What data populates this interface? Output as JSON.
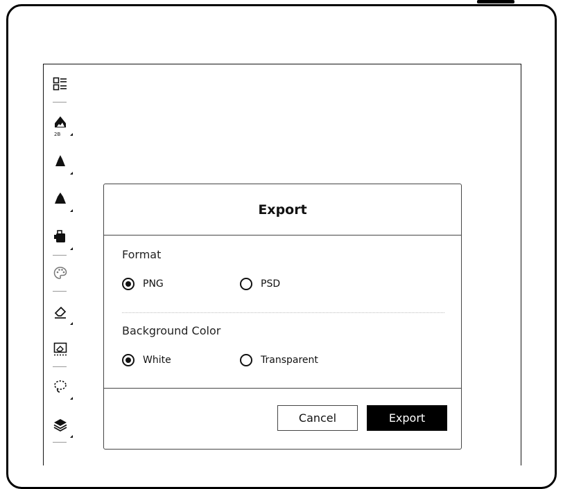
{
  "toolbar": {
    "items": [
      {
        "icon": "outline-list-icon"
      },
      {
        "icon": "pencil-icon",
        "label": "2B"
      },
      {
        "icon": "brush-icon"
      },
      {
        "icon": "marker-icon"
      },
      {
        "icon": "fill-bucket-icon"
      },
      {
        "icon": "palette-icon"
      },
      {
        "icon": "eraser-icon"
      },
      {
        "icon": "area-eraser-icon"
      },
      {
        "icon": "lasso-icon"
      },
      {
        "icon": "layers-icon"
      }
    ]
  },
  "dialog": {
    "title": "Export",
    "format": {
      "label": "Format",
      "options": [
        {
          "label": "PNG",
          "selected": true
        },
        {
          "label": "PSD",
          "selected": false
        }
      ]
    },
    "background": {
      "label": "Background Color",
      "options": [
        {
          "label": "White",
          "selected": true
        },
        {
          "label": "Transparent",
          "selected": false
        }
      ]
    },
    "cancel_label": "Cancel",
    "export_label": "Export"
  }
}
